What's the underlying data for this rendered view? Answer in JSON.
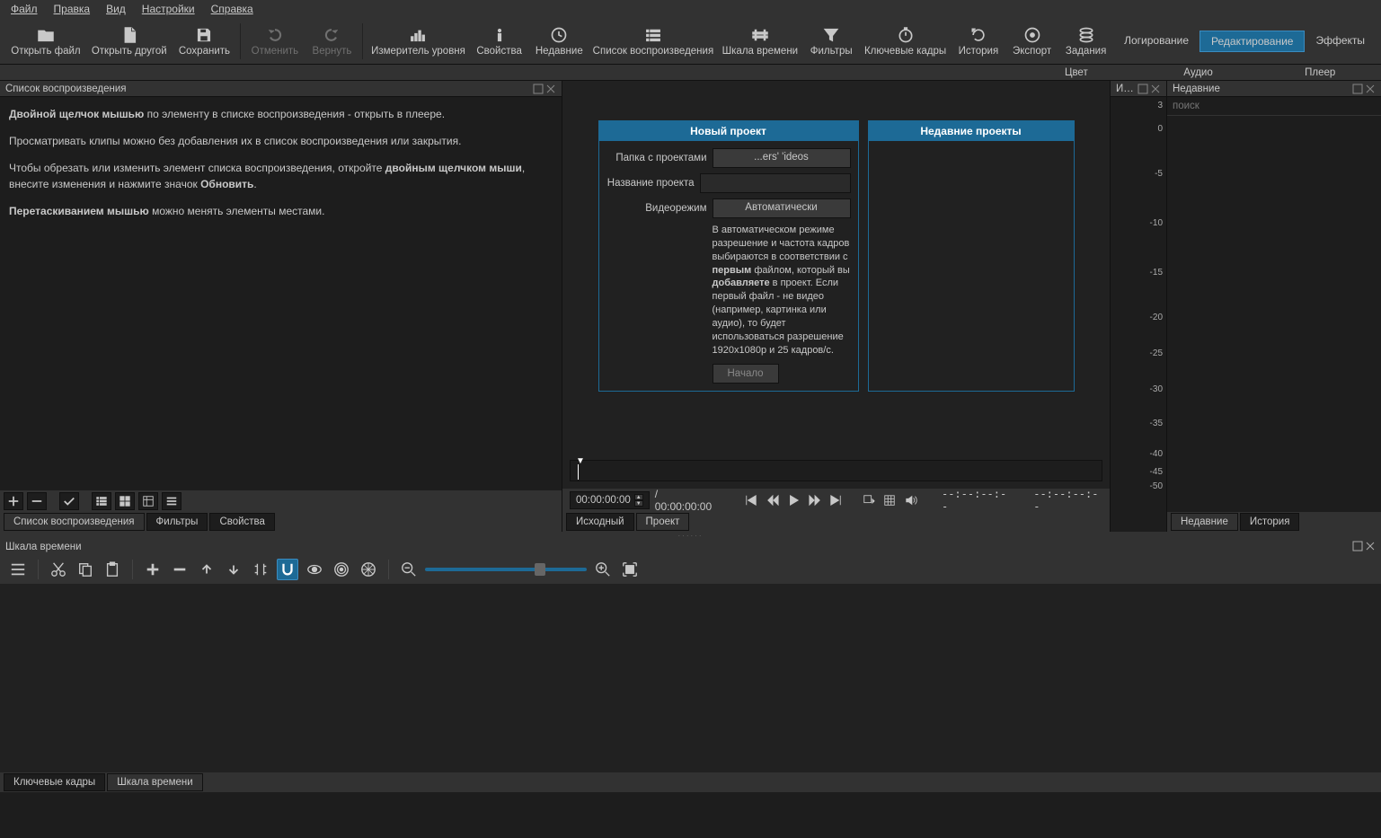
{
  "menubar": [
    "Файл",
    "Правка",
    "Вид",
    "Настройки",
    "Справка"
  ],
  "toolbar": [
    {
      "id": "open-file",
      "label": "Открыть файл"
    },
    {
      "id": "open-other",
      "label": "Открыть другой"
    },
    {
      "id": "save",
      "label": "Сохранить"
    },
    {
      "id": "undo",
      "label": "Отменить",
      "dim": true
    },
    {
      "id": "redo",
      "label": "Вернуть",
      "dim": true
    },
    {
      "id": "level-meter",
      "label": "Измеритель уровня"
    },
    {
      "id": "properties",
      "label": "Свойства"
    },
    {
      "id": "recent",
      "label": "Недавние"
    },
    {
      "id": "playlist",
      "label": "Список воспроизведения"
    },
    {
      "id": "timeline",
      "label": "Шкала времени"
    },
    {
      "id": "filters",
      "label": "Фильтры"
    },
    {
      "id": "keyframes",
      "label": "Ключевые кадры"
    },
    {
      "id": "history",
      "label": "История"
    },
    {
      "id": "export",
      "label": "Экспорт"
    },
    {
      "id": "jobs",
      "label": "Задания"
    }
  ],
  "layout_tabs": [
    "Логирование",
    "Редактирование",
    "Эффекты"
  ],
  "layout_active": 1,
  "sub_labels": [
    "Цвет",
    "Аудио",
    "Плеер"
  ],
  "playlist": {
    "title": "Список воспроизведения",
    "help_p1a": "Двойной щелчок мышью",
    "help_p1b": " по элементу в списке воспроизведения - открыть в плеере.",
    "help_p2": "Просматривать клипы можно без добавления их в список воспроизведения или закрытия.",
    "help_p3a": "Чтобы обрезать или изменить элемент списка воспроизведения, откройте ",
    "help_p3b": "двойным щелчком мыши",
    "help_p3c": ", внесите изменения и нажмите значок ",
    "help_p3d": "Обновить",
    "help_p3e": ".",
    "help_p4a": "Перетаскиванием мышью",
    "help_p4b": " можно менять элементы местами.",
    "tabs": [
      "Список воспроизведения",
      "Фильтры",
      "Свойства"
    ]
  },
  "preview": {
    "new_project": "Новый проект",
    "recent_projects": "Недавние проекты",
    "folder_label": "Папка с проектами",
    "folder_value": "...ers'                         'ideos",
    "name_label": "Название проекта",
    "name_value": "",
    "mode_label": "Видеорежим",
    "mode_value": "Автоматически",
    "auto_desc_1": "В автоматическом режиме разрешение и частота кадров выбираются в соответствии с ",
    "auto_desc_2": "первым",
    "auto_desc_3": " файлом, который вы ",
    "auto_desc_4": "добавляете",
    "auto_desc_5": " в проект. Если первый файл - не видео (например, картинка или аудио), то будет использоваться разрешение 1920x1080p и 25 кадров/с.",
    "start_btn": "Начало",
    "tc_current": "00:00:00:00",
    "tc_total_prefix": "/ ",
    "tc_total": "00:00:00:00",
    "tc_in": "--:--:--:--",
    "tc_out": "--:--:--:--",
    "tabs": [
      "Исходный",
      "Проект"
    ]
  },
  "meters": {
    "title": "Изм...",
    "ticks": [
      "3",
      "0",
      "-5",
      "-10",
      "-15",
      "-20",
      "-25",
      "-30",
      "-35",
      "-40",
      "-45",
      "-50"
    ]
  },
  "recent": {
    "title": "Недавние",
    "search_placeholder": "поиск",
    "tabs": [
      "Недавние",
      "История"
    ]
  },
  "timeline": {
    "title": "Шкала времени",
    "tabs": [
      "Ключевые кадры",
      "Шкала времени"
    ]
  }
}
